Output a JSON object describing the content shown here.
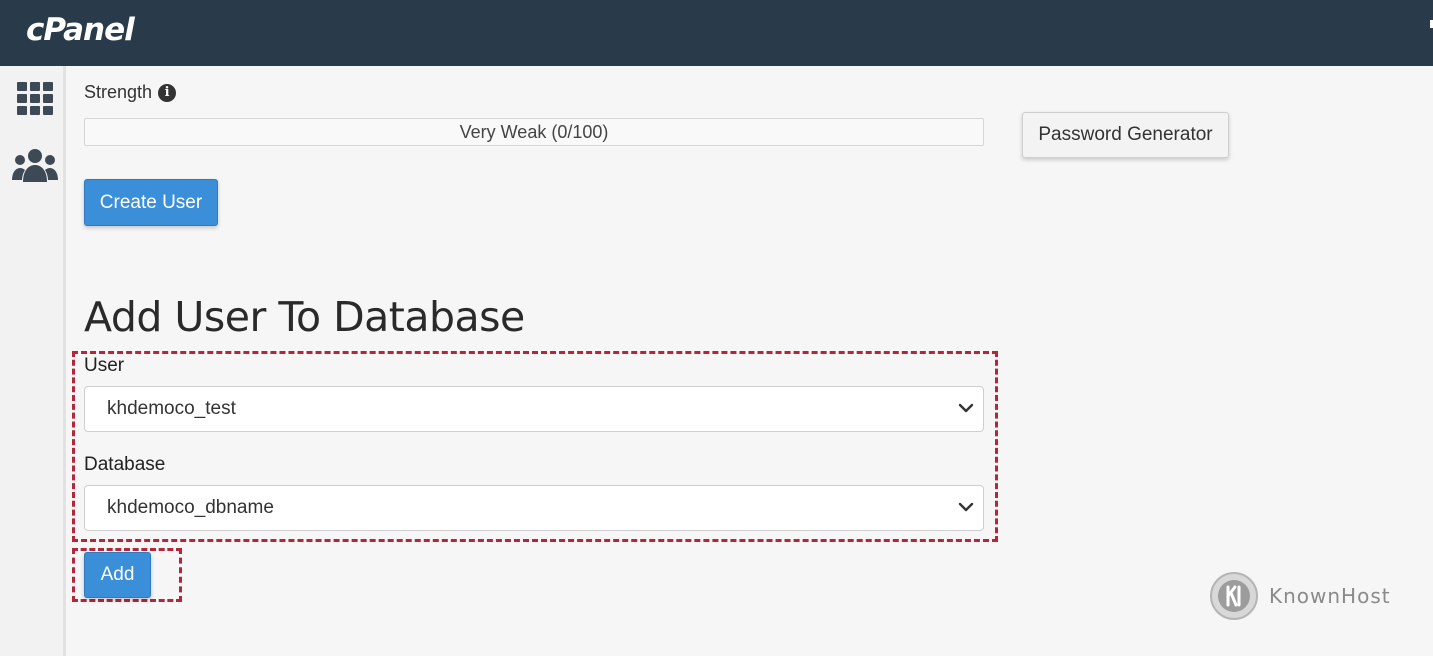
{
  "header": {
    "logo_text": "cPanel"
  },
  "sidebar": {
    "items": [
      {
        "icon": "apps-grid-icon"
      },
      {
        "icon": "users-icon"
      }
    ]
  },
  "password_strength": {
    "label": "Strength",
    "value_text": "Very Weak (0/100)",
    "value": 0,
    "max": 100
  },
  "buttons": {
    "password_generator": "Password Generator",
    "create_user": "Create User",
    "add": "Add"
  },
  "add_user_section": {
    "title": "Add User To Database",
    "user_label": "User",
    "user_value": "khdemoco_test",
    "database_label": "Database",
    "database_value": "khdemoco_dbname"
  },
  "watermark": {
    "text": "KnownHost"
  },
  "colors": {
    "header_bg": "#293a4a",
    "primary_button": "#3b8ed8",
    "highlight_dash": "#b5263a"
  }
}
